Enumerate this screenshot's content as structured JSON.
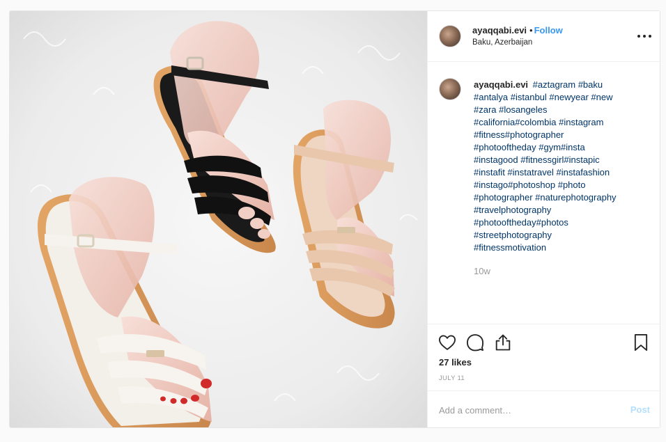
{
  "post": {
    "username": "ayaqqabi.evi",
    "separator": "•",
    "follow_label": "Follow",
    "location": "Baku, Azerbaijan",
    "caption_username": "ayaqqabi.evi",
    "caption_lines": [
      "#aztagram #baku",
      "#antalya #istanbul #newyear #new",
      "#zara #losangeles",
      "#california#colombia #instagram",
      "#fitness#photographer",
      "#photooftheday #gym#insta",
      "#instagood #fitnessgirl#instapic",
      "#instafit #instatravel #instafashion",
      "#instago#photoshop #photo",
      "#photographer #naturephotography",
      "#travelphotography",
      "#photooftheday#photos",
      "#streetphotography",
      "#fitnessmotivation"
    ],
    "age": "10w",
    "likes": "27 likes",
    "date": "JULY 11",
    "comment_placeholder": "Add a comment…",
    "post_label": "Post"
  },
  "icons": {
    "more": "more-options-icon",
    "like": "heart-icon",
    "comment": "comment-bubble-icon",
    "share": "share-icon",
    "save": "bookmark-icon"
  },
  "colors": {
    "link": "#3897f0",
    "hashtag": "#003569",
    "muted": "#999999",
    "post_disabled": "#b2dffc"
  }
}
